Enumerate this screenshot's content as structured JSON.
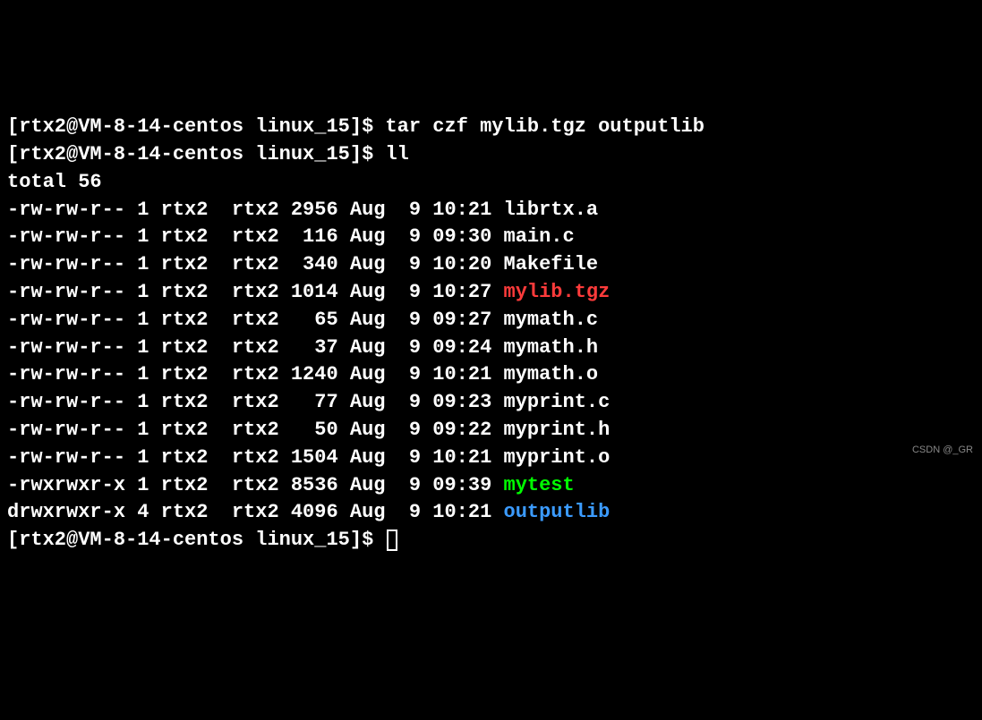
{
  "prompt1": {
    "prefix": "[rtx2@VM-8-14-centos linux_15]$ ",
    "command": "tar czf mylib.tgz outputlib"
  },
  "prompt2": {
    "prefix": "[rtx2@VM-8-14-centos linux_15]$ ",
    "command": "ll"
  },
  "total_line": "total 56",
  "files": [
    {
      "perm": "-rw-rw-r--",
      "links": "1",
      "owner": "rtx2",
      "group": "rtx2",
      "size": "2956",
      "month": "Aug",
      "day": " 9",
      "time": "10:21",
      "name": "librtx.a",
      "cls": "file-default"
    },
    {
      "perm": "-rw-rw-r--",
      "links": "1",
      "owner": "rtx2",
      "group": "rtx2",
      "size": " 116",
      "month": "Aug",
      "day": " 9",
      "time": "09:30",
      "name": "main.c",
      "cls": "file-default"
    },
    {
      "perm": "-rw-rw-r--",
      "links": "1",
      "owner": "rtx2",
      "group": "rtx2",
      "size": " 340",
      "month": "Aug",
      "day": " 9",
      "time": "10:20",
      "name": "Makefile",
      "cls": "file-default"
    },
    {
      "perm": "-rw-rw-r--",
      "links": "1",
      "owner": "rtx2",
      "group": "rtx2",
      "size": "1014",
      "month": "Aug",
      "day": " 9",
      "time": "10:27",
      "name": "mylib.tgz",
      "cls": "file-archive"
    },
    {
      "perm": "-rw-rw-r--",
      "links": "1",
      "owner": "rtx2",
      "group": "rtx2",
      "size": "  65",
      "month": "Aug",
      "day": " 9",
      "time": "09:27",
      "name": "mymath.c",
      "cls": "file-default"
    },
    {
      "perm": "-rw-rw-r--",
      "links": "1",
      "owner": "rtx2",
      "group": "rtx2",
      "size": "  37",
      "month": "Aug",
      "day": " 9",
      "time": "09:24",
      "name": "mymath.h",
      "cls": "file-default"
    },
    {
      "perm": "-rw-rw-r--",
      "links": "1",
      "owner": "rtx2",
      "group": "rtx2",
      "size": "1240",
      "month": "Aug",
      "day": " 9",
      "time": "10:21",
      "name": "mymath.o",
      "cls": "file-default"
    },
    {
      "perm": "-rw-rw-r--",
      "links": "1",
      "owner": "rtx2",
      "group": "rtx2",
      "size": "  77",
      "month": "Aug",
      "day": " 9",
      "time": "09:23",
      "name": "myprint.c",
      "cls": "file-default"
    },
    {
      "perm": "-rw-rw-r--",
      "links": "1",
      "owner": "rtx2",
      "group": "rtx2",
      "size": "  50",
      "month": "Aug",
      "day": " 9",
      "time": "09:22",
      "name": "myprint.h",
      "cls": "file-default"
    },
    {
      "perm": "-rw-rw-r--",
      "links": "1",
      "owner": "rtx2",
      "group": "rtx2",
      "size": "1504",
      "month": "Aug",
      "day": " 9",
      "time": "10:21",
      "name": "myprint.o",
      "cls": "file-default"
    },
    {
      "perm": "-rwxrwxr-x",
      "links": "1",
      "owner": "rtx2",
      "group": "rtx2",
      "size": "8536",
      "month": "Aug",
      "day": " 9",
      "time": "09:39",
      "name": "mytest",
      "cls": "file-exec"
    },
    {
      "perm": "drwxrwxr-x",
      "links": "4",
      "owner": "rtx2",
      "group": "rtx2",
      "size": "4096",
      "month": "Aug",
      "day": " 9",
      "time": "10:21",
      "name": "outputlib",
      "cls": "file-dir"
    }
  ],
  "prompt3": {
    "prefix": "[rtx2@VM-8-14-centos linux_15]$ "
  },
  "watermark": "CSDN @_GR"
}
